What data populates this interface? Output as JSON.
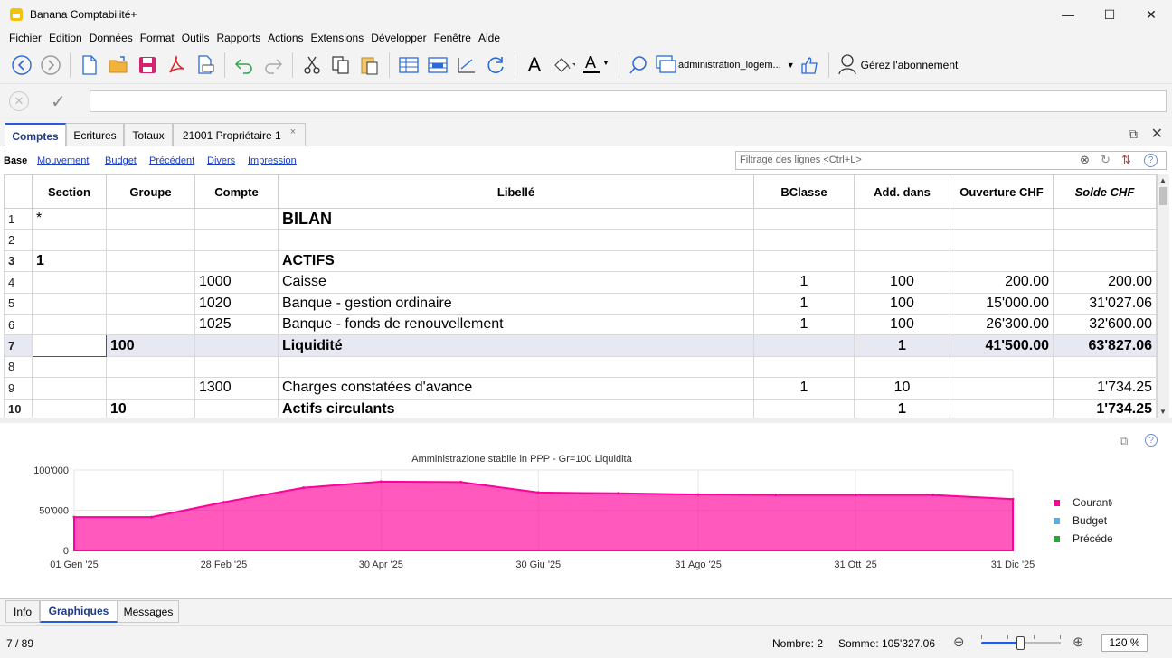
{
  "window": {
    "title": "Banana Comptabilité+",
    "minimize": "—",
    "maximize": "☐",
    "close": "✕"
  },
  "menu": [
    "Fichier",
    "Edition",
    "Données",
    "Format",
    "Outils",
    "Rapports",
    "Actions",
    "Extensions",
    "Développer",
    "Fenêtre",
    "Aide"
  ],
  "toolbar": {
    "file_label": "administration_logem...",
    "subscription_label": "Gérez l'abonnement",
    "font_letter": "A",
    "highlight_letter": "A"
  },
  "edit_bar": {
    "input_value": "",
    "cancel_glyph": "✕",
    "ok_glyph": "✓"
  },
  "doc_tabs": [
    {
      "label": "Comptes",
      "active": true
    },
    {
      "label": "Ecritures",
      "active": false
    },
    {
      "label": "Totaux",
      "active": false
    },
    {
      "label": "21001 Propriétaire 1",
      "active": false,
      "closable": true
    }
  ],
  "doc_tab_close": "×",
  "doc_restore": "⧉",
  "doc_close": "✕",
  "views": [
    "Base",
    "Mouvement",
    "Budget",
    "Précédent",
    "Divers",
    "Impression"
  ],
  "filter": {
    "placeholder": "Filtrage des lignes <Ctrl+L>",
    "clear_icon": "⊗",
    "refresh_icon": "↻",
    "sort_icon": "⇅",
    "help_icon": "?"
  },
  "table": {
    "columns": [
      "",
      "Section",
      "Groupe",
      "Compte",
      "Libellé",
      "BClasse",
      "Add. dans",
      "Ouverture CHF",
      "Solde CHF"
    ],
    "rows": [
      {
        "n": "1",
        "section": "*",
        "groupe": "",
        "compte": "",
        "libelle": "BILAN",
        "bclasse": "",
        "add": "",
        "ouv": "",
        "solde": "",
        "style": "title"
      },
      {
        "n": "2",
        "section": "",
        "groupe": "",
        "compte": "",
        "libelle": "",
        "bclasse": "",
        "add": "",
        "ouv": "",
        "solde": "",
        "style": ""
      },
      {
        "n": "3",
        "section": "1",
        "groupe": "",
        "compte": "",
        "libelle": "ACTIFS",
        "bclasse": "",
        "add": "",
        "ouv": "",
        "solde": "",
        "style": "bold"
      },
      {
        "n": "4",
        "section": "",
        "groupe": "",
        "compte": "1000",
        "libelle": "Caisse",
        "bclasse": "1",
        "add": "100",
        "ouv": "200.00",
        "solde": "200.00",
        "style": ""
      },
      {
        "n": "5",
        "section": "",
        "groupe": "",
        "compte": "1020",
        "libelle": "Banque - gestion ordinaire",
        "bclasse": "1",
        "add": "100",
        "ouv": "15'000.00",
        "solde": "31'027.06",
        "style": ""
      },
      {
        "n": "6",
        "section": "",
        "groupe": "",
        "compte": "1025",
        "libelle": "Banque - fonds de renouvellement",
        "bclasse": "1",
        "add": "100",
        "ouv": "26'300.00",
        "solde": "32'600.00",
        "style": ""
      },
      {
        "n": "7",
        "section": "",
        "groupe": "100",
        "compte": "",
        "libelle": "Liquidité",
        "bclasse": "",
        "add": "1",
        "ouv": "41'500.00",
        "solde": "63'827.06",
        "style": "bold sel"
      },
      {
        "n": "8",
        "section": "",
        "groupe": "",
        "compte": "",
        "libelle": "",
        "bclasse": "",
        "add": "",
        "ouv": "",
        "solde": "",
        "style": ""
      },
      {
        "n": "9",
        "section": "",
        "groupe": "",
        "compte": "1300",
        "libelle": "Charges constatées d'avance",
        "bclasse": "1",
        "add": "10",
        "ouv": "",
        "solde": "1'734.25",
        "style": ""
      },
      {
        "n": "10",
        "section": "",
        "groupe": "10",
        "compte": "",
        "libelle": "Actifs circulants",
        "bclasse": "",
        "add": "1",
        "ouv": "",
        "solde": "1'734.25",
        "style": "bold"
      }
    ]
  },
  "chart_data": {
    "type": "area",
    "title": "Amministrazione stabile in PPP - Gr=100 Liquidità",
    "x": [
      "2025-01-01",
      "2025-01-31",
      "2025-02-28",
      "2025-03-31",
      "2025-04-30",
      "2025-05-31",
      "2025-06-30",
      "2025-07-31",
      "2025-08-31",
      "2025-09-30",
      "2025-10-31",
      "2025-11-30",
      "2025-12-31"
    ],
    "x_tick_labels": [
      "01 Gen '25",
      "28 Feb '25",
      "30 Apr '25",
      "30 Giu '25",
      "31 Ago '25",
      "31 Ott '25",
      "31 Dic '25"
    ],
    "y_tick_labels": [
      "100'000",
      "50'000",
      "0"
    ],
    "ylim": [
      0,
      100000
    ],
    "grid": true,
    "legend_position": "right",
    "series": [
      {
        "name": "Courante",
        "color": "#ff0099",
        "values": [
          41500,
          41500,
          60000,
          78000,
          85500,
          85000,
          72000,
          71000,
          69500,
          69000,
          69000,
          69000,
          63827
        ]
      },
      {
        "name": "Budget",
        "color": "#4fb3e8",
        "values": []
      },
      {
        "name": "Précédente",
        "color": "#22aa33",
        "values": []
      }
    ]
  },
  "chart_panel": {
    "copy_icon": "⧉",
    "help_icon": "?"
  },
  "bottom_tabs": [
    {
      "label": "Info",
      "active": false
    },
    {
      "label": "Graphiques",
      "active": true
    },
    {
      "label": "Messages",
      "active": false
    }
  ],
  "status": {
    "position": "7 / 89",
    "count": "Nombre: 2",
    "sum": "Somme: 105'327.06",
    "zoom": "120 %",
    "zoom_out_icon": "⊖",
    "zoom_in_icon": "⊕",
    "zoom_level": 0.5
  },
  "colors": {
    "accent": "#2a5bd7",
    "link": "#1a3fc4",
    "selection_row": "#e6e8f2",
    "chart_area": "#ff0099"
  }
}
